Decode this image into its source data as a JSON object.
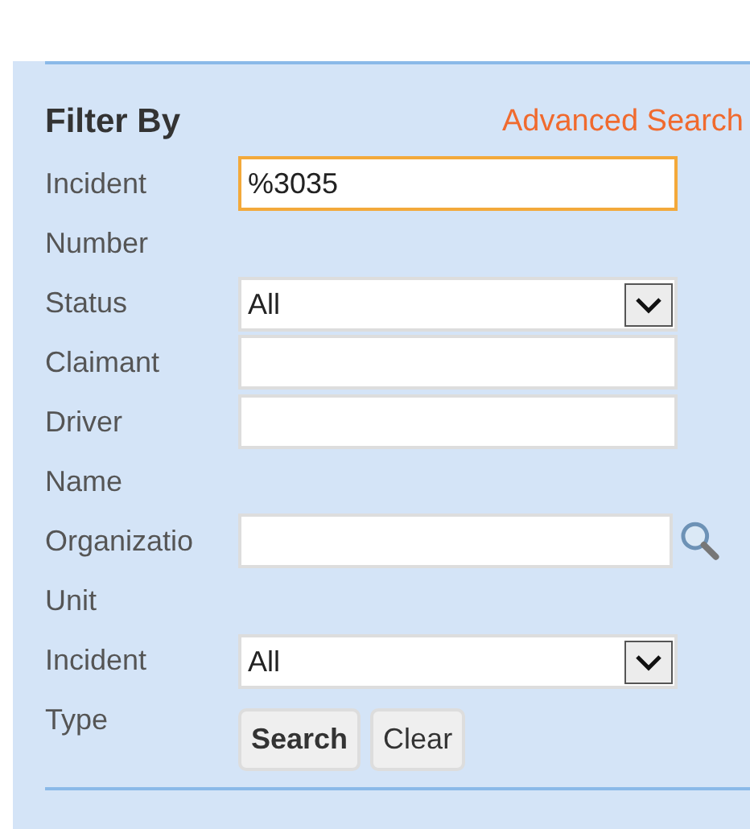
{
  "filter": {
    "title": "Filter By",
    "advanced_link": "Advanced Search",
    "fields": [
      {
        "kind": "text",
        "label": "Incident Number",
        "value": "%3035",
        "focused": true
      },
      {
        "kind": "select",
        "label": "Status",
        "value": "All",
        "focused": false
      },
      {
        "kind": "text",
        "label": "Claimant",
        "focused": false
      },
      {
        "kind": "text",
        "label": "Driver Name",
        "focused": false
      },
      {
        "kind": "lookup",
        "label": "Organizatio Unit",
        "focused": false
      },
      {
        "kind": "select",
        "label": "Incident Type",
        "value": "All",
        "focused": false
      }
    ],
    "buttons": [
      {
        "label": "Search",
        "primary": true
      },
      {
        "label": "Clear",
        "primary": false
      }
    ]
  }
}
